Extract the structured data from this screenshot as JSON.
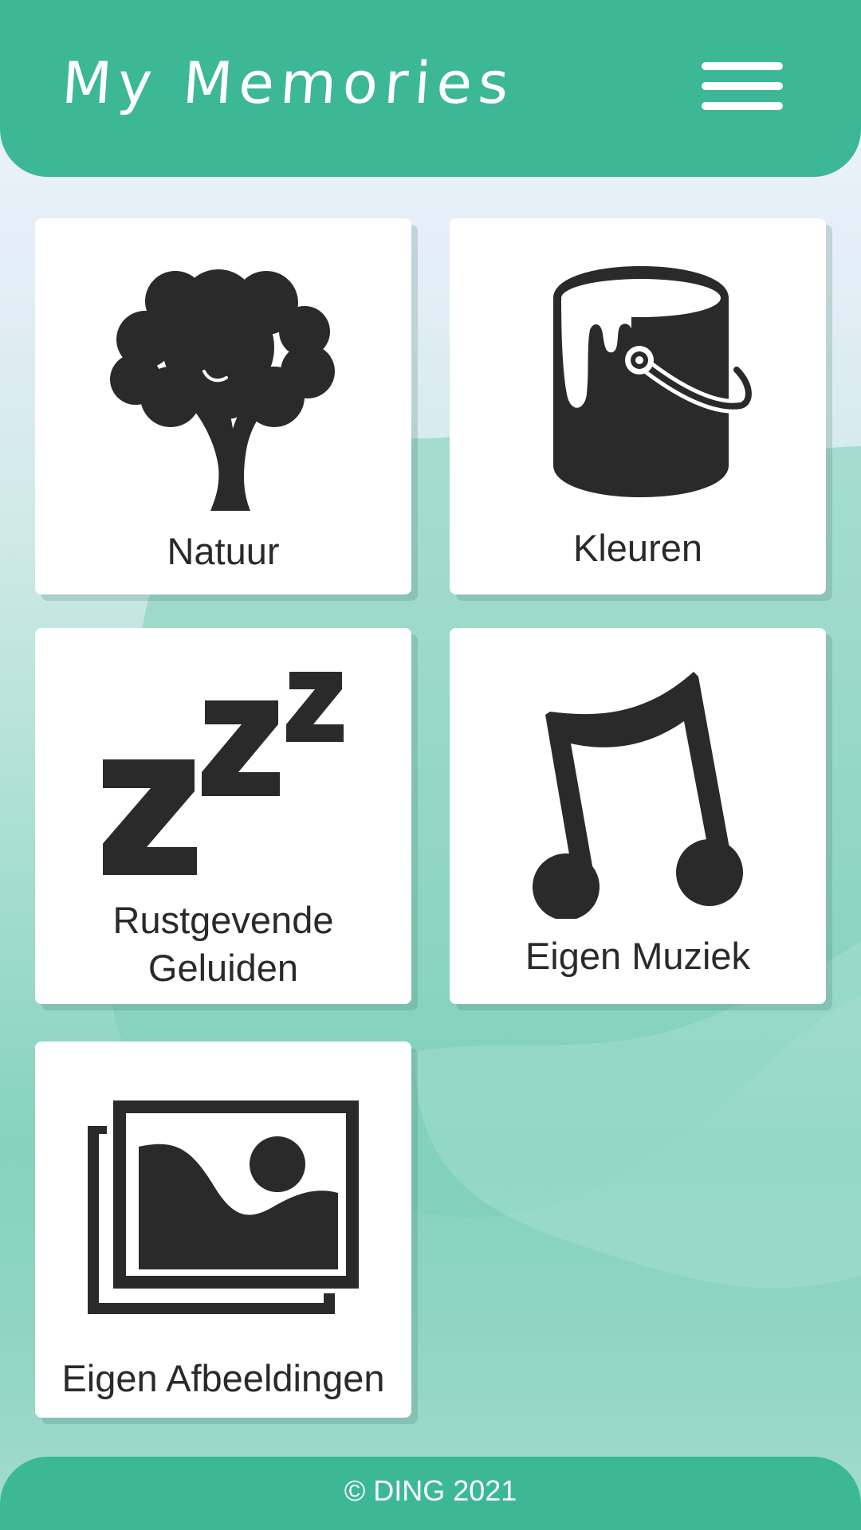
{
  "header": {
    "title": "My Memories",
    "menu_icon": "hamburger-menu-icon"
  },
  "tiles": [
    {
      "label": "Natuur",
      "icon": "tree-icon"
    },
    {
      "label": "Kleuren",
      "icon": "paint-bucket-icon"
    },
    {
      "label_line1": "Rustgevende",
      "label_line2": "Geluiden",
      "icon": "sleep-zzz-icon"
    },
    {
      "label": "Eigen Muziek",
      "icon": "music-note-icon"
    },
    {
      "label": "Eigen Afbeeldingen",
      "icon": "images-icon"
    }
  ],
  "footer": {
    "text": "© DING 2021"
  },
  "colors": {
    "brand": "#3db896",
    "tile_background": "#ffffff",
    "icon": "#2a2a2a"
  }
}
